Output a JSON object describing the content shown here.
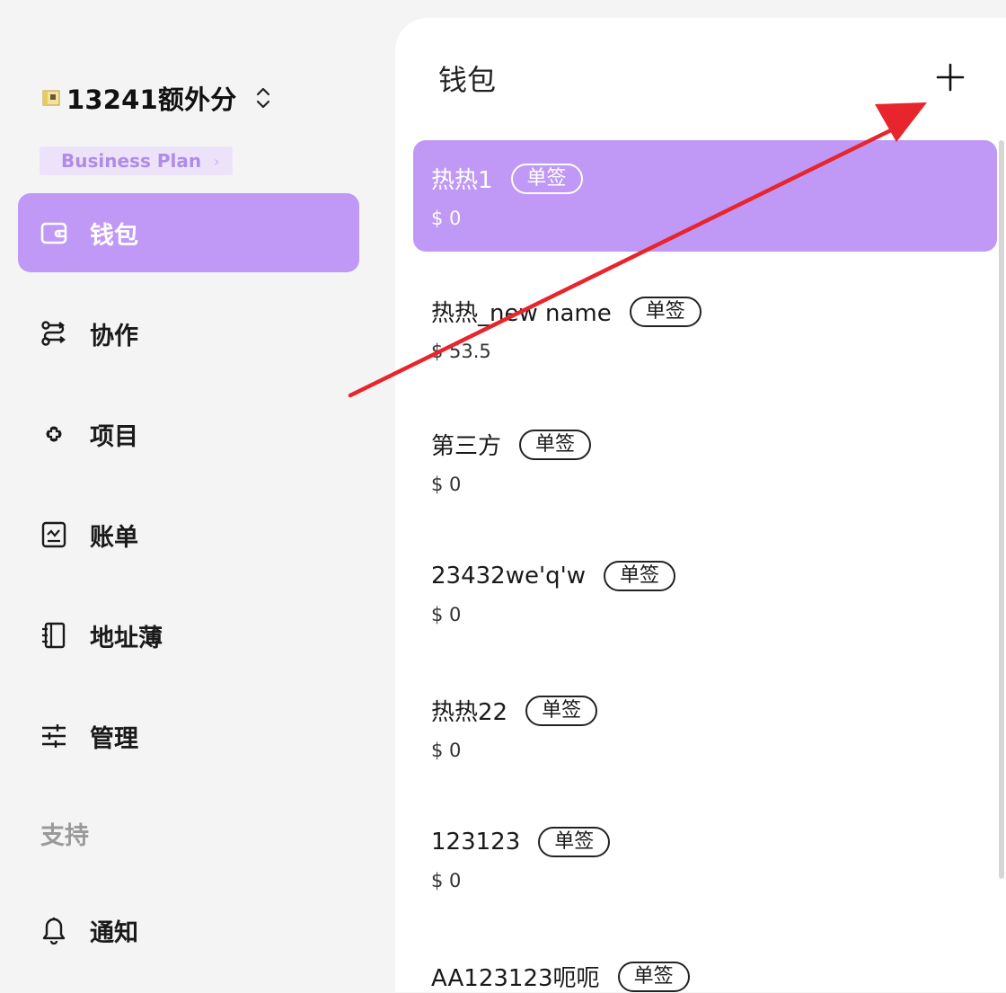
{
  "sidebar": {
    "org_name": "13241额外分",
    "plan_label": "Business Plan",
    "plan_chevron": "›",
    "nav": [
      {
        "label": "钱包",
        "icon": "wallet-icon",
        "active": true
      },
      {
        "label": "协作",
        "icon": "collaboration-icon",
        "active": false
      },
      {
        "label": "项目",
        "icon": "project-icon",
        "active": false
      },
      {
        "label": "账单",
        "icon": "bill-icon",
        "active": false
      },
      {
        "label": "地址薄",
        "icon": "address-book-icon",
        "active": false
      },
      {
        "label": "管理",
        "icon": "settings-sliders-icon",
        "active": false
      }
    ],
    "support_label": "支持",
    "support_nav": [
      {
        "label": "通知",
        "icon": "bell-icon",
        "active": false
      }
    ]
  },
  "main": {
    "title": "钱包",
    "add_icon": "plus-icon",
    "wallets": [
      {
        "name": "热热1",
        "tag": "单签",
        "balance": "$ 0",
        "active": true
      },
      {
        "name": "热热_new name",
        "tag": "单签",
        "balance": "$ 53.5",
        "active": false
      },
      {
        "name": "第三方",
        "tag": "单签",
        "balance": "$ 0",
        "active": false
      },
      {
        "name": "23432we'q'w",
        "tag": "单签",
        "balance": "$ 0",
        "active": false
      },
      {
        "name": "热热22",
        "tag": "单签",
        "balance": "$ 0",
        "active": false
      },
      {
        "name": "123123",
        "tag": "单签",
        "balance": "$ 0",
        "active": false
      },
      {
        "name": "AA123123呃呃",
        "tag": "单签",
        "balance": "",
        "active": false
      }
    ]
  },
  "colors": {
    "accent": "#c098f6",
    "plan_bg": "#ece3fa",
    "plan_text": "#b08be8",
    "annotation": "#e8242c"
  }
}
